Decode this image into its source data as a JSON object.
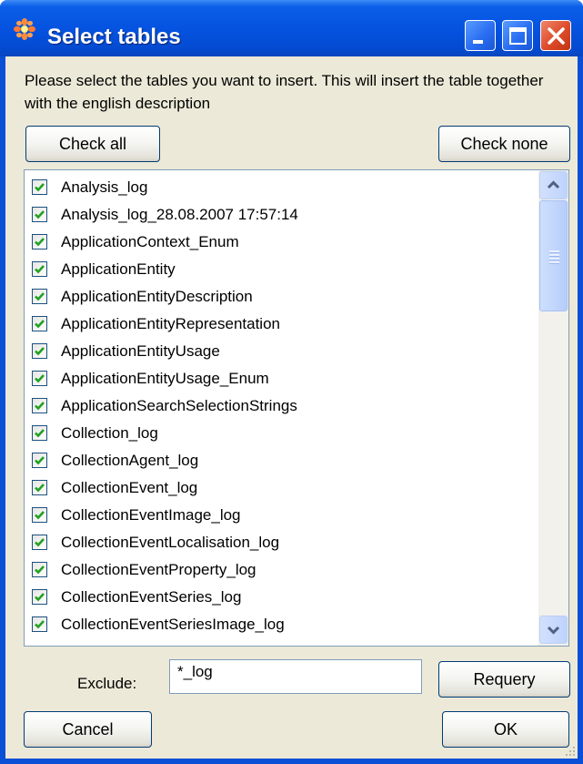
{
  "window": {
    "title": "Select tables",
    "icon": "app-flower-icon",
    "controls": {
      "minimize": "minimize-icon",
      "maximize": "maximize-icon",
      "close": "close-icon"
    }
  },
  "description": "Please select the tables you want to insert. This will insert the table together with the english description",
  "buttons": {
    "check_all": "Check all",
    "check_none": "Check none",
    "requery": "Requery",
    "cancel": "Cancel",
    "ok": "OK"
  },
  "table_list": {
    "items": [
      {
        "label": "Analysis_log",
        "checked": true
      },
      {
        "label": "Analysis_log_28.08.2007 17:57:14",
        "checked": true
      },
      {
        "label": "ApplicationContext_Enum",
        "checked": true
      },
      {
        "label": "ApplicationEntity",
        "checked": true
      },
      {
        "label": "ApplicationEntityDescription",
        "checked": true
      },
      {
        "label": "ApplicationEntityRepresentation",
        "checked": true
      },
      {
        "label": "ApplicationEntityUsage",
        "checked": true
      },
      {
        "label": "ApplicationEntityUsage_Enum",
        "checked": true
      },
      {
        "label": "ApplicationSearchSelectionStrings",
        "checked": true
      },
      {
        "label": "Collection_log",
        "checked": true
      },
      {
        "label": "CollectionAgent_log",
        "checked": true
      },
      {
        "label": "CollectionEvent_log",
        "checked": true
      },
      {
        "label": "CollectionEventImage_log",
        "checked": true
      },
      {
        "label": "CollectionEventLocalisation_log",
        "checked": true
      },
      {
        "label": "CollectionEventProperty_log",
        "checked": true
      },
      {
        "label": "CollectionEventSeries_log",
        "checked": true
      },
      {
        "label": "CollectionEventSeriesImage_log",
        "checked": true
      }
    ]
  },
  "exclude": {
    "label": "Exclude:",
    "value": "*_log"
  },
  "colors": {
    "title_bar": "#0553e0",
    "dialog_background": "#ece9d8",
    "check_mark": "#21a121",
    "button_border": "#003c74"
  }
}
